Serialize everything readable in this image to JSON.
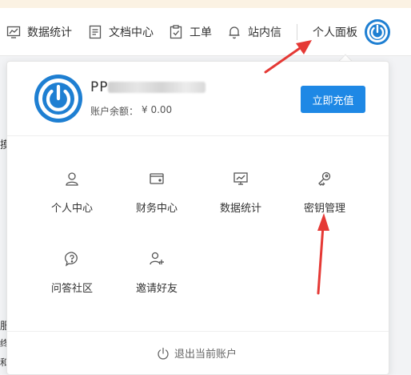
{
  "nav": {
    "items": [
      {
        "label": "数据统计",
        "icon": "chart-icon"
      },
      {
        "label": "文档中心",
        "icon": "document-icon"
      },
      {
        "label": "工单",
        "icon": "clipboard-check-icon"
      },
      {
        "label": "站内信",
        "icon": "bell-icon"
      }
    ],
    "personal_panel": "个人面板"
  },
  "left_edge": [
    "摸",
    "服",
    "终",
    "和"
  ],
  "dropdown": {
    "username": "PP",
    "balance_label": "账户余额：",
    "balance_value": "¥ 0.00",
    "recharge_button": "立即充值",
    "grid": [
      {
        "label": "个人中心",
        "icon": "user-icon"
      },
      {
        "label": "财务中心",
        "icon": "wallet-icon"
      },
      {
        "label": "数据统计",
        "icon": "chart-board-icon"
      },
      {
        "label": "密钥管理",
        "icon": "key-icon"
      },
      {
        "label": "问答社区",
        "icon": "question-bubble-icon"
      },
      {
        "label": "邀请好友",
        "icon": "add-user-icon"
      }
    ],
    "logout": "退出当前账户"
  },
  "colors": {
    "accent": "#1e88e5",
    "annotation_arrow": "#e53935"
  }
}
